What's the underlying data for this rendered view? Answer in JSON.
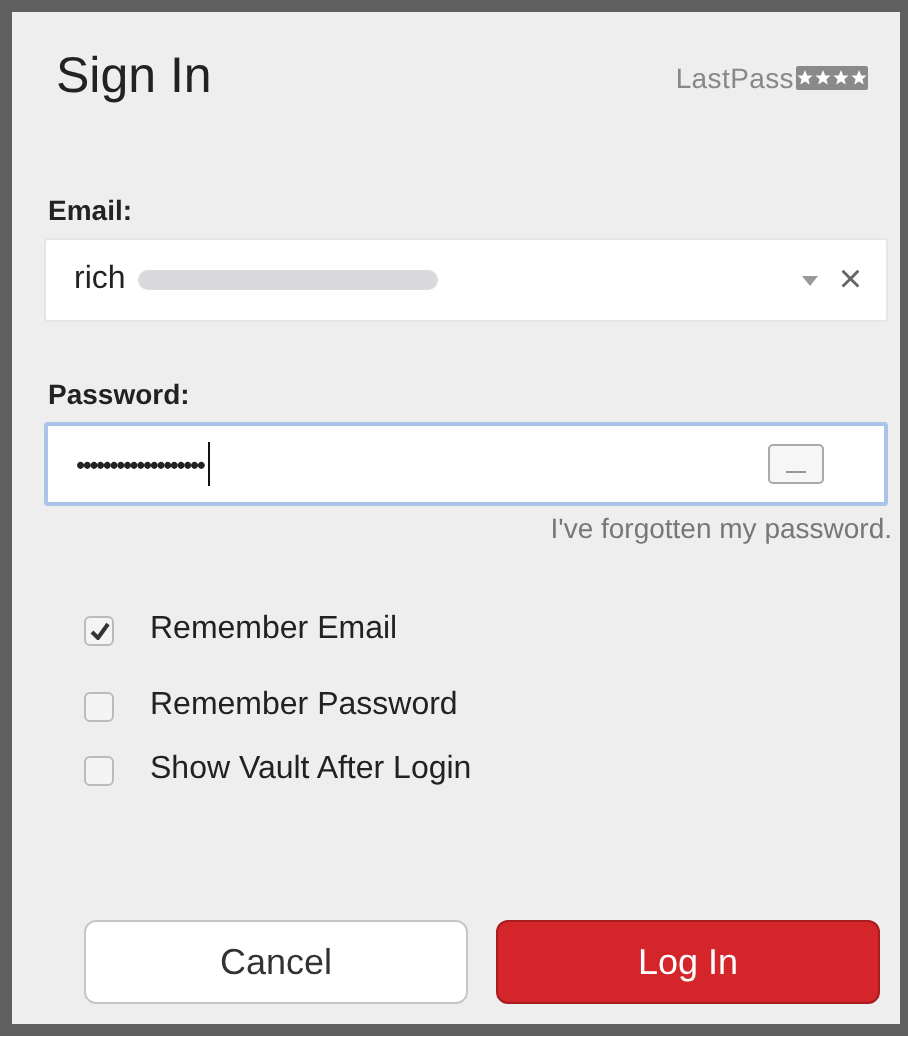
{
  "dialog": {
    "title": "Sign In",
    "brand": "LastPass"
  },
  "email": {
    "label": "Email:",
    "value": "rich",
    "clear": "×"
  },
  "password": {
    "label": "Password:",
    "value": "•••••••••••••••••••",
    "focused": true
  },
  "forgot_link": "I've forgotten my password.",
  "options": [
    {
      "label": "Remember Email",
      "checked": true
    },
    {
      "label": "Remember Password",
      "checked": false
    },
    {
      "label": "Show Vault After Login",
      "checked": false
    }
  ],
  "buttons": [
    {
      "label": "Cancel",
      "kind": "secondary"
    },
    {
      "label": "Log In",
      "kind": "primary"
    }
  ]
}
